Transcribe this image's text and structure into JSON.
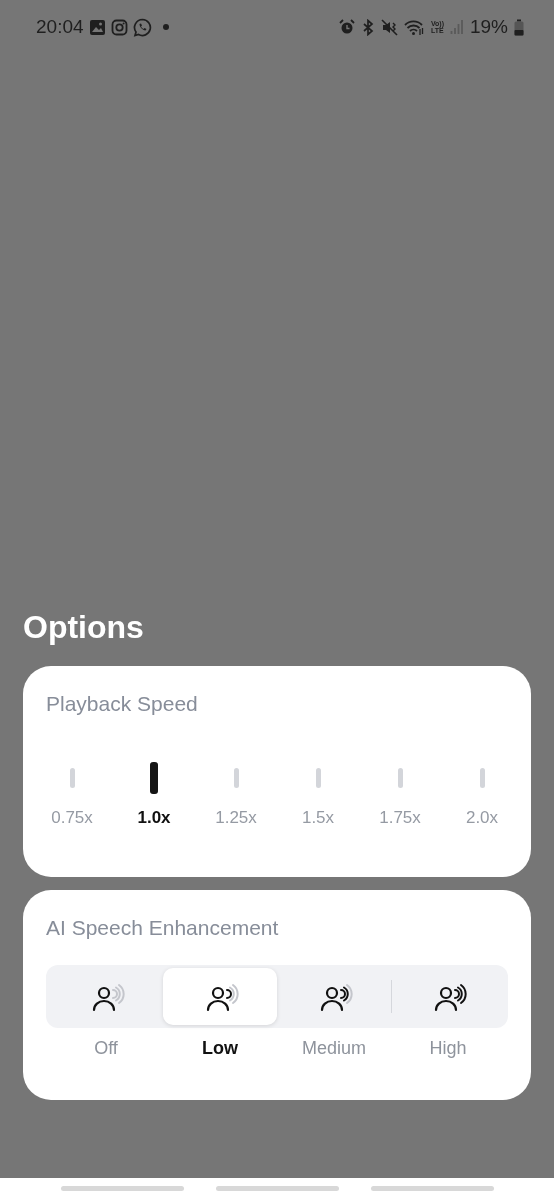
{
  "status_bar": {
    "time": "20:04",
    "volte_top": "Vo))",
    "volte_bottom": "LTE",
    "battery": "19%"
  },
  "title": "Options",
  "playback_speed": {
    "title": "Playback Speed",
    "options": [
      {
        "label": "0.75x",
        "selected": false
      },
      {
        "label": "1.0x",
        "selected": true
      },
      {
        "label": "1.25x",
        "selected": false
      },
      {
        "label": "1.5x",
        "selected": false
      },
      {
        "label": "1.75x",
        "selected": false
      },
      {
        "label": "2.0x",
        "selected": false
      }
    ]
  },
  "speech_enhancement": {
    "title": "AI Speech Enhancement",
    "options": [
      {
        "label": "Off",
        "kind": "off",
        "selected": false
      },
      {
        "label": "Low",
        "kind": "low",
        "selected": true
      },
      {
        "label": "Medium",
        "kind": "medium",
        "selected": false
      },
      {
        "label": "High",
        "kind": "high",
        "selected": false
      }
    ]
  }
}
